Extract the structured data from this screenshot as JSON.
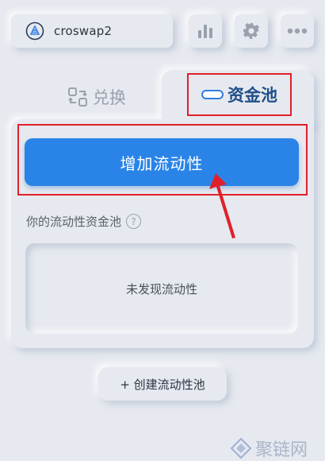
{
  "header": {
    "account_name": "croswap2",
    "account_icon": "croswap-logo-icon",
    "chart_icon": "bar-chart-icon",
    "settings_icon": "gear-icon",
    "more_icon": "ellipsis-icon"
  },
  "tabs": {
    "swap_label": "兑换",
    "pool_label": "资金池",
    "active": "pool"
  },
  "pool": {
    "add_liquidity_label": "增加流动性",
    "your_pools_label": "你的流动性资金池",
    "help_glyph": "?",
    "empty_text": "未发现流动性",
    "create_pool_label": "+ 创建流动性池"
  },
  "watermark": {
    "text": "聚链网"
  },
  "colors": {
    "background": "#e6e9ef",
    "primary": "#2a84e8",
    "highlight": "#e0202a",
    "active_tab_text": "#1f4f8a"
  }
}
